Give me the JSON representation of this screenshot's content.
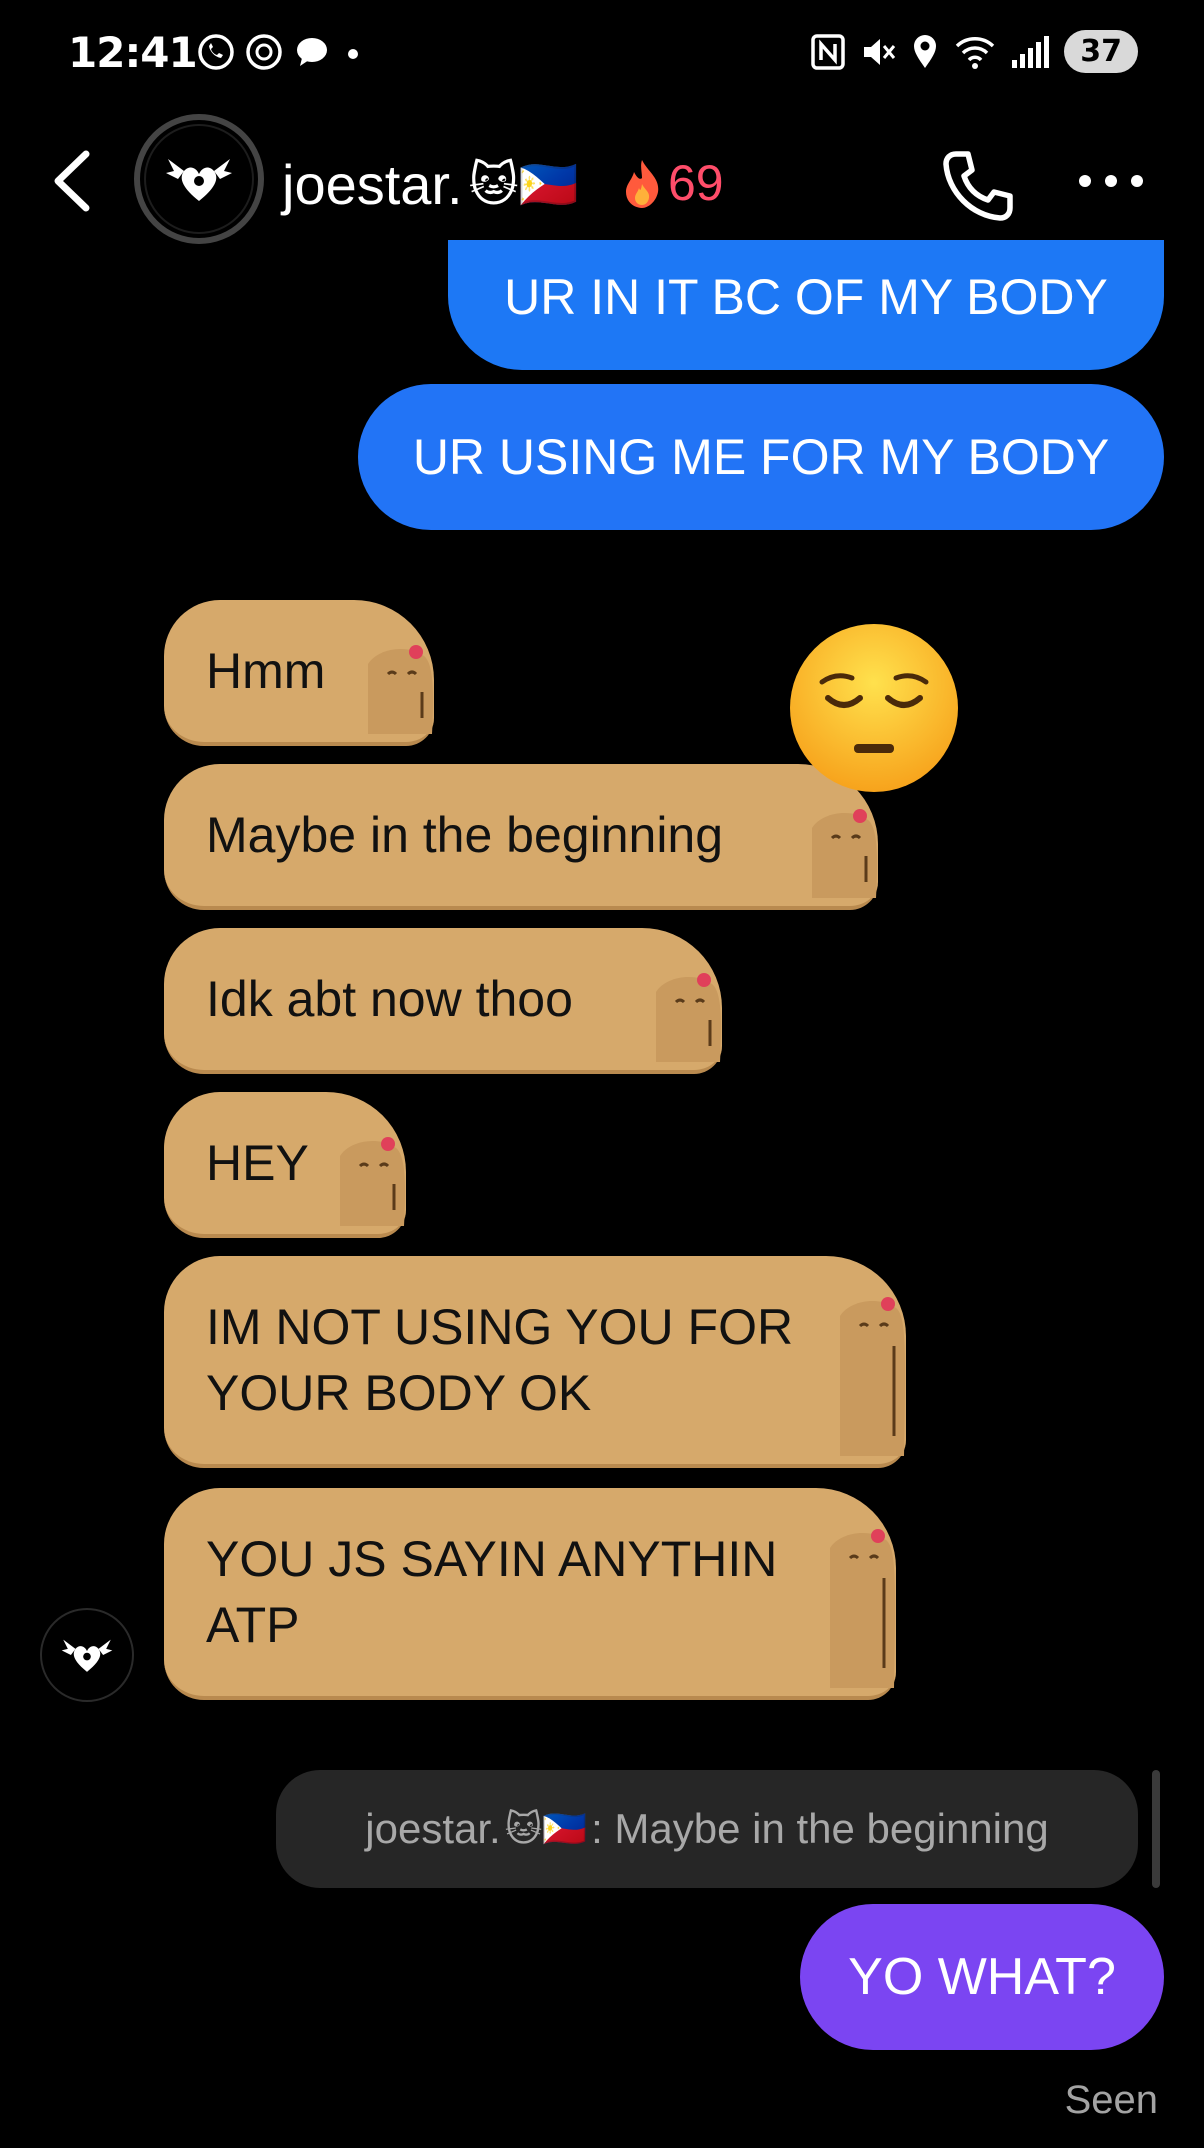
{
  "status_bar": {
    "time": "12:41",
    "battery": "37"
  },
  "header": {
    "contact_name": "joestar.",
    "contact_emojis": "🐱🇵🇭",
    "streak_count": "69",
    "streak_icon": "fire-icon"
  },
  "messages": [
    {
      "direction": "outgoing",
      "text": "UR IN IT BC OF MY BODY"
    },
    {
      "direction": "outgoing",
      "text": "UR USING ME FOR MY BODY"
    },
    {
      "direction": "incoming",
      "text": "Hmm"
    },
    {
      "direction": "incoming",
      "text": "Maybe in the beginning",
      "reaction": "😔"
    },
    {
      "direction": "incoming",
      "text": "Idk abt now thoo"
    },
    {
      "direction": "incoming",
      "text": "HEY"
    },
    {
      "direction": "incoming",
      "text_line1": "IM NOT USING YOU FOR",
      "text_line2": "YOUR BODY OK"
    },
    {
      "direction": "incoming",
      "text_line1": "YOU JS SAYIN ANYTHIN",
      "text_line2": "ATP"
    }
  ],
  "reply": {
    "quoted_sender": "joestar.",
    "quoted_emojis": "🐱🇵🇭",
    "quoted_text": ": Maybe in the beginning",
    "message": "YO WHAT?"
  },
  "seen_label": "Seen",
  "colors": {
    "background": "#000000",
    "outgoing_bubble": "#1d78f5",
    "incoming_bubble": "#d6a96b",
    "reply_bubble": "#7b45f2",
    "streak": "#ff4d6a"
  }
}
